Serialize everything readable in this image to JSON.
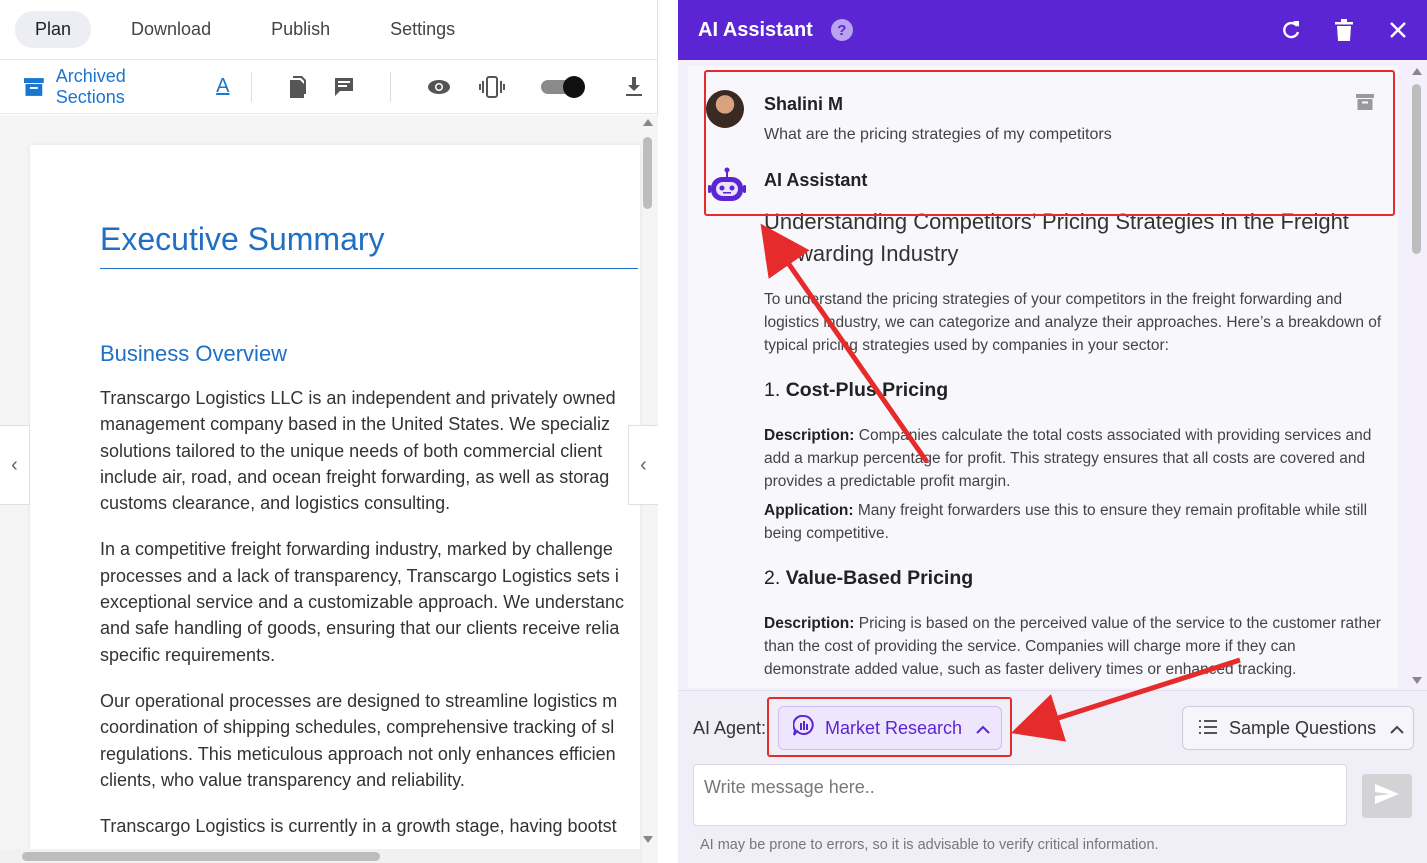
{
  "left": {
    "tabs": [
      {
        "label": "Plan",
        "active": true
      },
      {
        "label": "Download"
      },
      {
        "label": "Publish"
      },
      {
        "label": "Settings"
      }
    ],
    "toolbar": {
      "archived_label": "Archived Sections",
      "font_letter": "A"
    },
    "doc": {
      "title": "Executive Summary",
      "section": "Business Overview",
      "paragraphs": [
        [
          "Transcargo Logistics LLC is an independent and privately owned",
          "management company based in the United States. We specializ",
          "solutions tailored to the unique needs of both commercial client",
          "include air, road, and ocean freight forwarding, as well as storag",
          "customs clearance, and logistics consulting."
        ],
        [
          "In a competitive freight forwarding industry, marked by challenge",
          "processes and a lack of transparency, Transcargo Logistics sets i",
          "exceptional service and a customizable approach. We understanc",
          "and safe handling of goods, ensuring that our clients receive relia",
          "specific requirements."
        ],
        [
          "Our operational processes are designed to streamline logistics m",
          "coordination of shipping schedules, comprehensive tracking of sl",
          "regulations. This meticulous approach not only enhances efficien",
          "clients, who value transparency and reliability."
        ],
        [
          "Transcargo Logistics is currently in a growth stage, having bootst"
        ]
      ]
    }
  },
  "assistant": {
    "title": "AI Assistant",
    "help": "?",
    "user": {
      "name": "Shalini M",
      "message": "What are the pricing strategies of my competitors"
    },
    "bot_name": "AI Assistant",
    "answer": {
      "title": "Understanding Competitors’ Pricing Strategies in the Freight Forwarding Industry",
      "intro": "To understand the pricing strategies of your competitors in the freight forwarding and logistics industry, we can categorize and analyze their approaches. Here’s a breakdown of typical pricing strategies used by companies in your sector:",
      "sections": [
        {
          "num": "1.",
          "heading": "Cost-Plus Pricing",
          "desc_label": "Description:",
          "desc": "Companies calculate the total costs associated with providing services and add a markup percentage for profit. This strategy ensures that all costs are covered and provides a predictable profit margin.",
          "app_label": "Application:",
          "app": "Many freight forwarders use this to ensure they remain profitable while still being competitive."
        },
        {
          "num": "2.",
          "heading": "Value-Based Pricing",
          "desc_label": "Description:",
          "desc": "Pricing is based on the perceived value of the service to the customer rather than the cost of providing the service. Companies will charge more if they can demonstrate added value, such as faster delivery times or enhanced tracking."
        }
      ]
    },
    "footer": {
      "agent_label": "AI Agent:",
      "agent_value": "Market Research",
      "sample_label": "Sample Questions",
      "input_placeholder": "Write message here..",
      "disclaimer": "AI may be prone to errors, so it is advisable to verify critical information."
    }
  },
  "colors": {
    "header_purple": "#5b25d4",
    "link_blue": "#1976d2",
    "doc_heading_blue": "#1f6fc5",
    "annotation_red": "#e52b2b"
  }
}
